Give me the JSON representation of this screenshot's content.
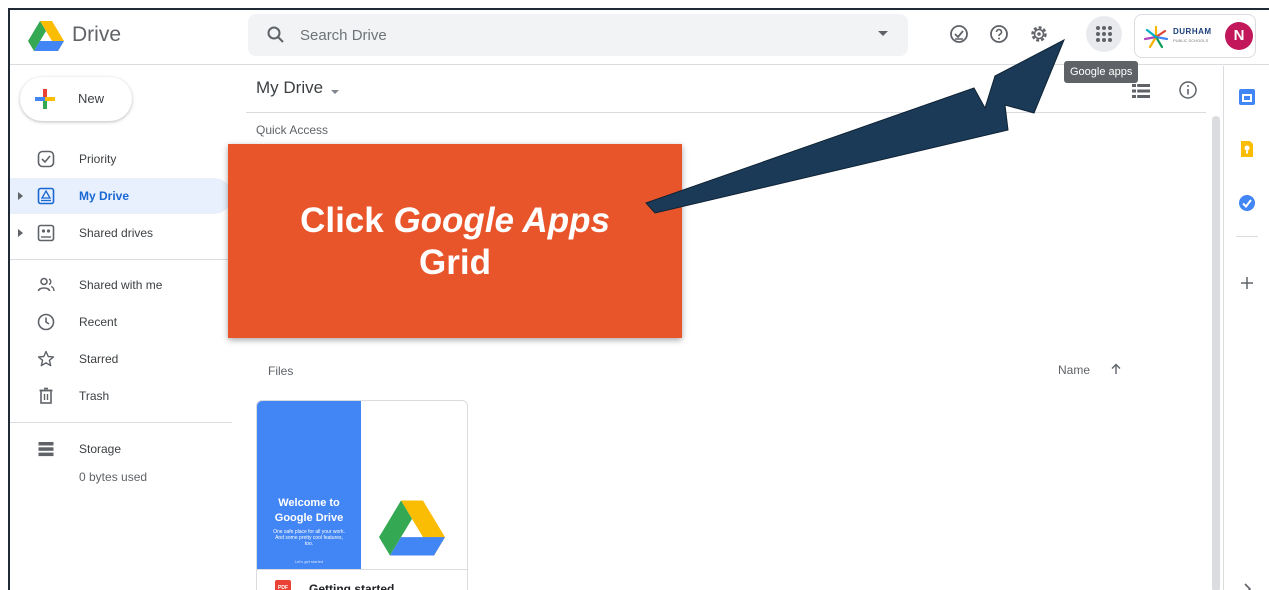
{
  "header": {
    "app_name": "Drive",
    "search_placeholder": "Search Drive",
    "org_name": "DURHAM",
    "org_sub": "PUBLIC SCHOOLS",
    "avatar_initial": "N",
    "tooltip": "Google apps",
    "icons": [
      "drive-logo-icon",
      "search-icon",
      "chevron-down-icon",
      "offline-icon",
      "help-icon",
      "settings-icon",
      "apps-grid-icon"
    ]
  },
  "sidebar": {
    "new_label": "New",
    "items": [
      {
        "label": "Priority",
        "icon": "priority-icon"
      },
      {
        "label": "My Drive",
        "icon": "my-drive-icon",
        "active": true
      },
      {
        "label": "Shared drives",
        "icon": "shared-drives-icon"
      },
      {
        "label": "Shared with me",
        "icon": "shared-with-me-icon"
      },
      {
        "label": "Recent",
        "icon": "clock-icon"
      },
      {
        "label": "Starred",
        "icon": "star-icon"
      },
      {
        "label": "Trash",
        "icon": "trash-icon"
      },
      {
        "label": "Storage",
        "icon": "storage-icon"
      }
    ],
    "storage_used": "0 bytes used"
  },
  "main": {
    "title": "My Drive",
    "quick_access": "Quick Access",
    "files_label": "Files",
    "sort_label": "Name",
    "file": {
      "thumb_title": "Welcome to Google Drive",
      "thumb_sub": "One safe place for all your work. And some pretty cool features, too.",
      "thumb_link": "Let's get started",
      "type_badge": "PDF",
      "name": "Getting started"
    }
  },
  "callout": {
    "line1_plain": "Click ",
    "line1_italic": "Google Apps",
    "line2": "Grid"
  },
  "colors": {
    "callout": "#e9552a",
    "arrow": "#1b3a57",
    "active_nav": "#e8f0fe",
    "accent_blue": "#1967d2"
  }
}
